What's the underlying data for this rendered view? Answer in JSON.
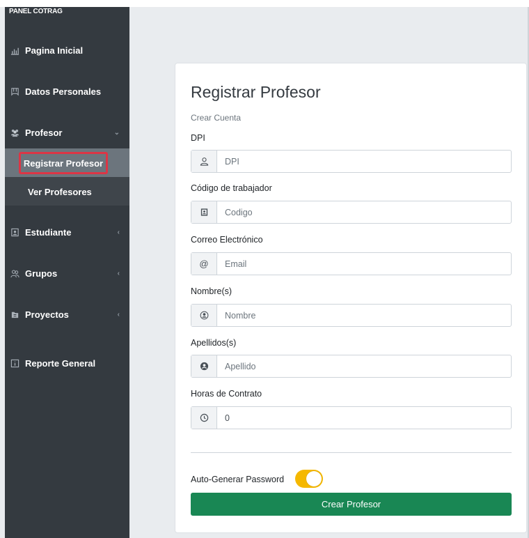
{
  "sidebar": {
    "brand": "PANEL COTRAG",
    "items": [
      {
        "label": "Pagina Inicial",
        "icon": "bar-chart-icon"
      },
      {
        "label": "Datos Personales",
        "icon": "id-card-icon"
      },
      {
        "label": "Profesor",
        "icon": "users-icon"
      },
      {
        "label": "Estudiante",
        "icon": "student-icon"
      },
      {
        "label": "Grupos",
        "icon": "group-icon"
      },
      {
        "label": "Proyectos",
        "icon": "projects-icon"
      },
      {
        "label": "Reporte General",
        "icon": "report-icon"
      }
    ],
    "submenu": {
      "active": "Registrar Profesor",
      "second": "Ver Profesores"
    },
    "arrow_down": "⌄",
    "arrow_left": "‹"
  },
  "form": {
    "title": "Registrar Profesor",
    "subtitle": "Crear Cuenta",
    "fields": [
      {
        "label": "DPI",
        "placeholder": "DPI",
        "value": "",
        "icon": "user-outline-icon"
      },
      {
        "label": "Código de trabajador",
        "placeholder": "Codigo",
        "value": "",
        "icon": "badge-icon"
      },
      {
        "label": "Correo Electrónico",
        "placeholder": "Email",
        "value": "",
        "icon": "at-icon"
      },
      {
        "label": "Nombre(s)",
        "placeholder": "Nombre",
        "value": "",
        "icon": "user-circle-icon"
      },
      {
        "label": "Apellidos(s)",
        "placeholder": "Apellido",
        "value": "",
        "icon": "user-circle-solid-icon"
      },
      {
        "label": "Horas de Contrato",
        "placeholder": "",
        "value": "0",
        "icon": "clock-icon"
      }
    ],
    "toggle_label": "Auto-Generar Password",
    "toggle_on": true,
    "submit_label": "Crear Profesor"
  },
  "colors": {
    "sidebar": "#343a40",
    "active_item": "#6c757d",
    "highlight_border": "#dc3545",
    "toggle": "#f5b800",
    "button": "#198754"
  }
}
